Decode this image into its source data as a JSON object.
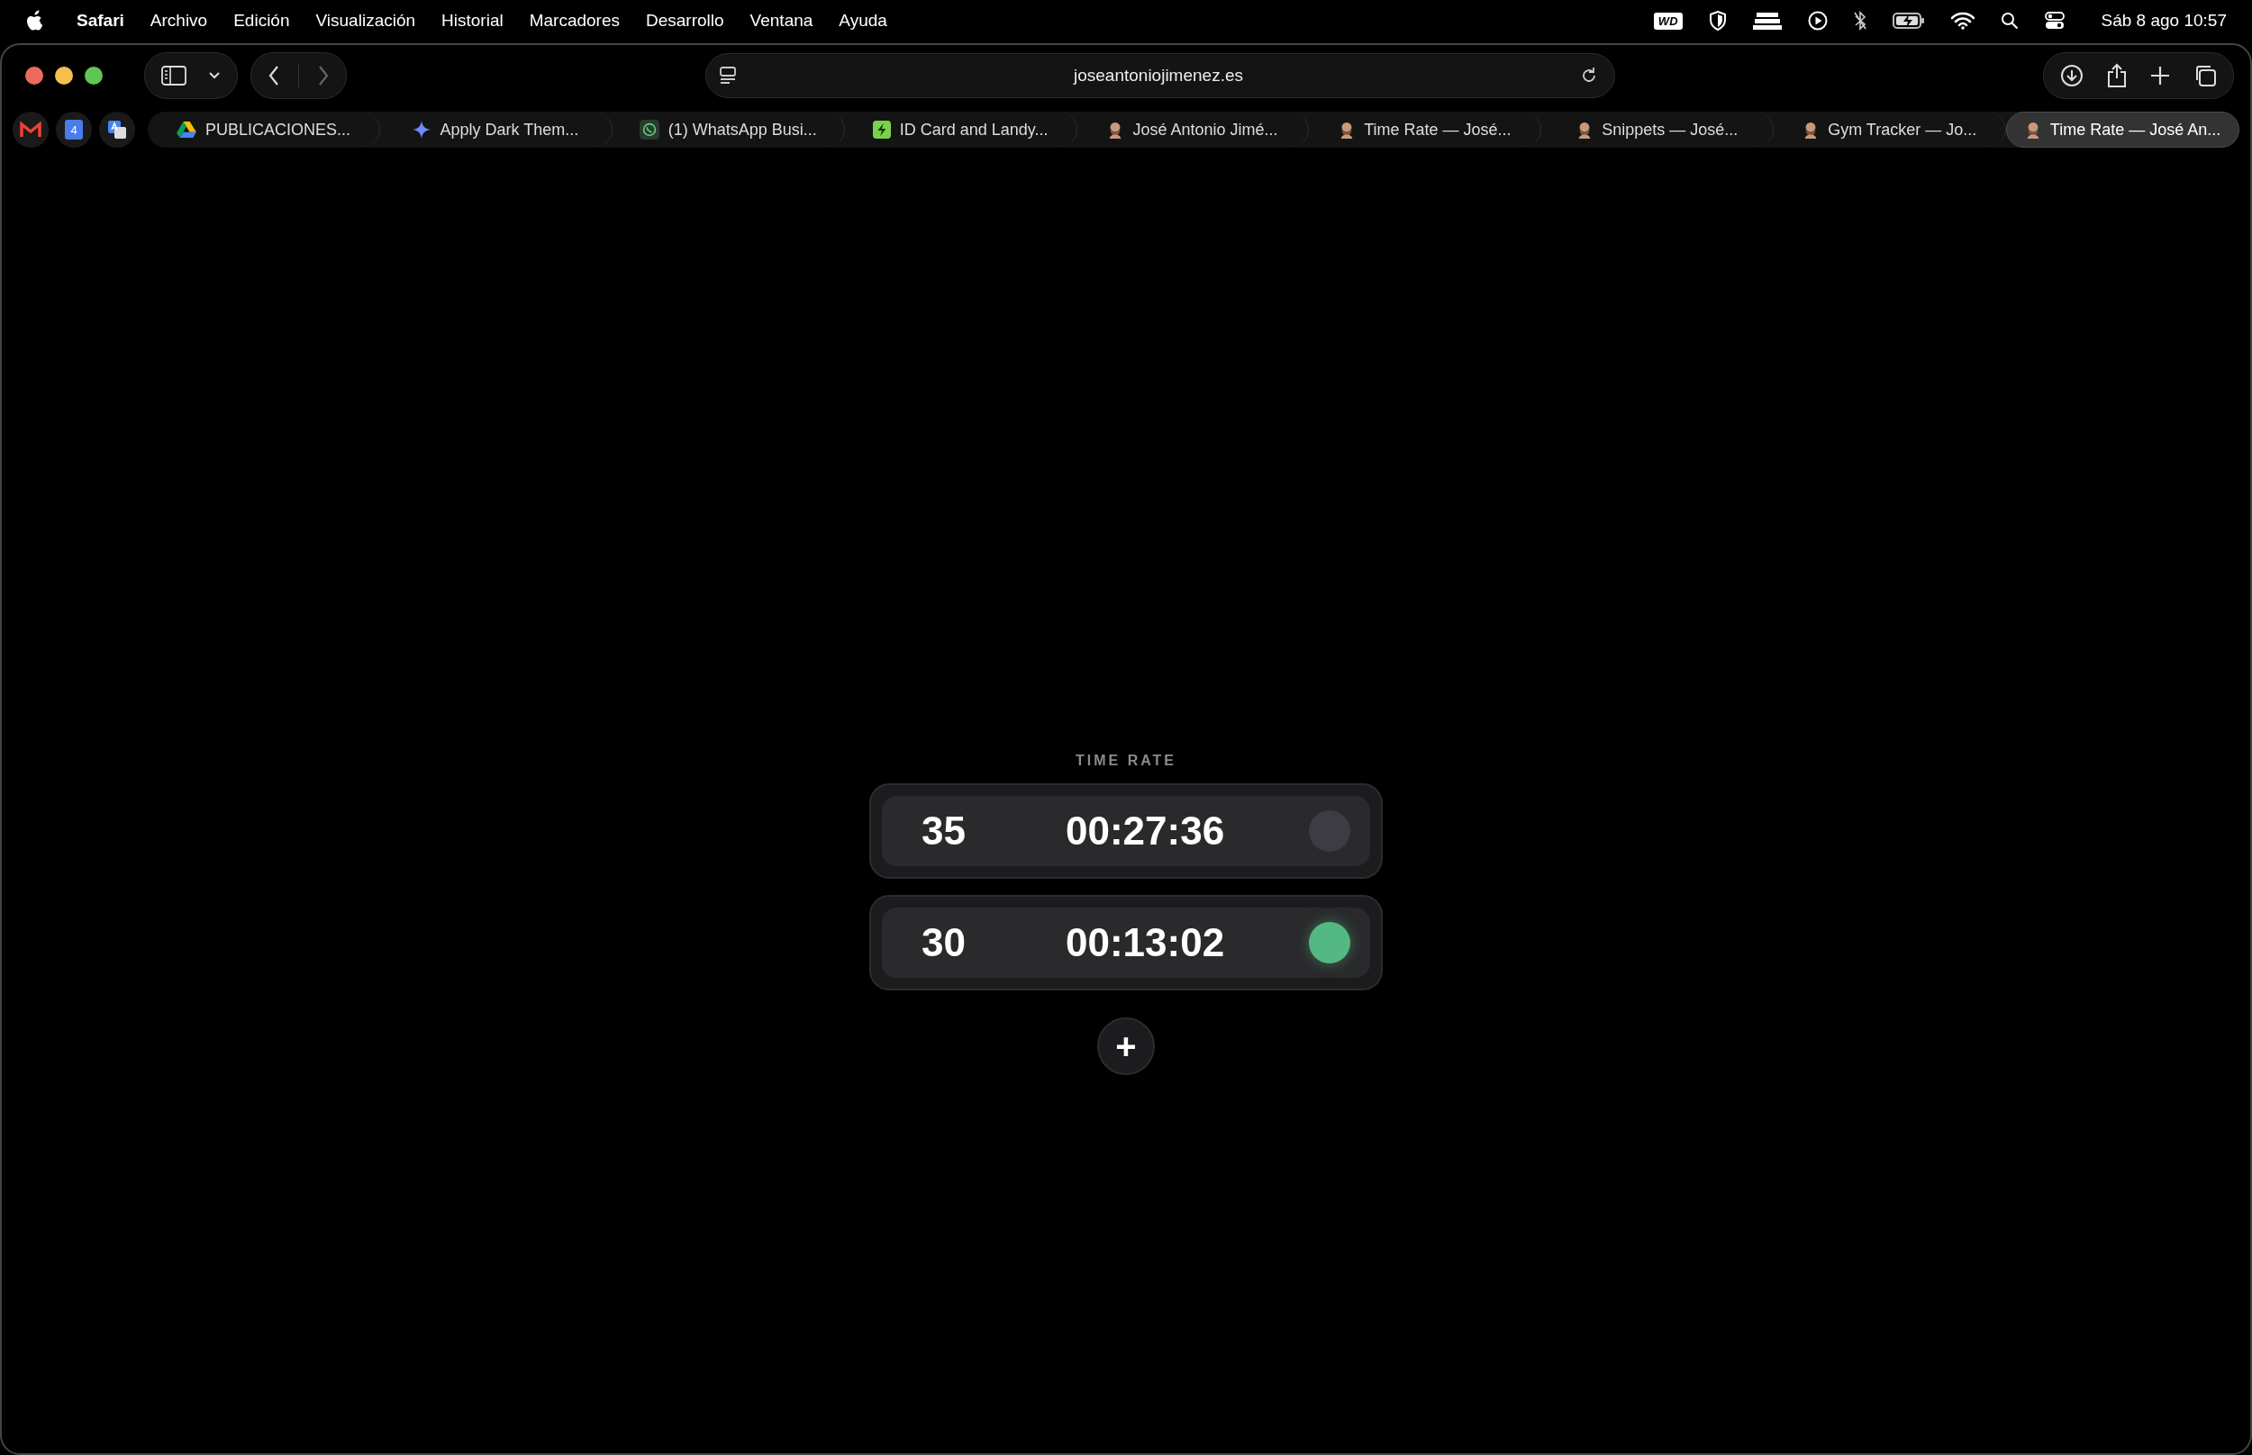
{
  "menu_bar": {
    "app": "Safari",
    "menus": [
      "Archivo",
      "Edición",
      "Visualización",
      "Historial",
      "Marcadores",
      "Desarrollo",
      "Ventana",
      "Ayuda"
    ],
    "drive_badge": "WD",
    "clock": "Sáb 8 ago 10:57"
  },
  "toolbar": {
    "url": "joseantoniojimenez.es"
  },
  "pinned_tabs": [
    {
      "kind": "mail"
    },
    {
      "kind": "calendar",
      "label": "4"
    },
    {
      "kind": "translate"
    }
  ],
  "tabs": [
    {
      "kind": "drive",
      "label": "PUBLICACIONES...",
      "selected": false
    },
    {
      "kind": "sparkle",
      "label": "Apply Dark Them...",
      "selected": false
    },
    {
      "kind": "chat",
      "label": "(1) WhatsApp Busi...",
      "selected": false
    },
    {
      "kind": "bolt",
      "label": "ID Card and Landy...",
      "selected": false
    },
    {
      "kind": "avatar",
      "label": "José Antonio Jimé...",
      "selected": false
    },
    {
      "kind": "avatar",
      "label": "Time Rate — José...",
      "selected": false
    },
    {
      "kind": "avatar",
      "label": "Snippets — José...",
      "selected": false
    },
    {
      "kind": "avatar",
      "label": "Gym Tracker — Jo...",
      "selected": false
    },
    {
      "kind": "avatar",
      "label": "Time Rate — José An...",
      "selected": true
    }
  ],
  "app": {
    "title": "TIME RATE",
    "timers": [
      {
        "rate": "35",
        "elapsed": "00:27:36",
        "running": false
      },
      {
        "rate": "30",
        "elapsed": "00:13:02",
        "running": true
      }
    ],
    "add_button": "+"
  }
}
